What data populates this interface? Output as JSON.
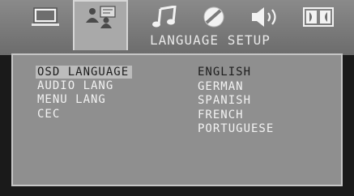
{
  "header": {
    "title": "LANGUAGE SETUP"
  },
  "tabs": [
    {
      "icon": "monitor-icon",
      "active": false
    },
    {
      "icon": "people-icon",
      "active": true
    },
    {
      "icon": "music-note-icon",
      "active": false
    },
    {
      "icon": "disc-icon",
      "active": false
    },
    {
      "icon": "speaker-icon",
      "active": false
    },
    {
      "icon": "dolby-icon",
      "active": false
    }
  ],
  "menu": {
    "items": [
      {
        "label": "OSD LANGUAGE",
        "selected": true
      },
      {
        "label": "AUDIO LANG"
      },
      {
        "label": "MENU LANG"
      },
      {
        "label": "CEC"
      }
    ]
  },
  "options": {
    "items": [
      {
        "label": "ENGLISH",
        "current": true
      },
      {
        "label": "GERMAN"
      },
      {
        "label": "SPANISH"
      },
      {
        "label": "FRENCH"
      },
      {
        "label": "PORTUGUESE"
      }
    ]
  },
  "colors": {
    "tab_bar": "#7a7a7a",
    "active_tab": "#a9a9a9",
    "panel": "#8f8f8f",
    "highlight": "#bcbcbc",
    "text": "#f2f2f2"
  }
}
